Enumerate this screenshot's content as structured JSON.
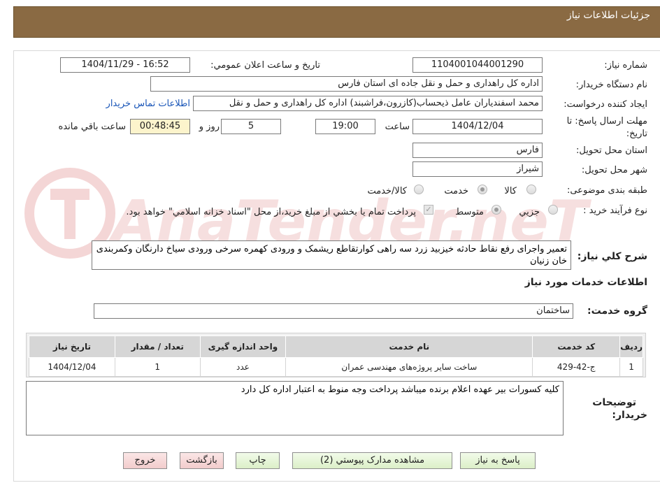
{
  "header": {
    "title": "جزئیات اطلاعات نیاز"
  },
  "form": {
    "need_number_label": "شماره نیاز:",
    "need_number": "1104001044001290",
    "announce_label": "تاریخ و ساعت اعلان عمومي:",
    "announce_value": "1404/11/29 - 16:52",
    "buyer_org_label": "نام دستگاه خريدار:",
    "buyer_org": "اداره کل راهداری و حمل و نقل جاده ای استان فارس",
    "requester_label": "ايجاد کننده درخواست:",
    "requester": "محمد اسفندیاران عامل ذیحساب(کازرون،فراشبند) اداره کل راهداری و حمل و نقل",
    "contact_link": "اطلاعات تماس خريدار",
    "deadline_label_1": "مهلت ارسال پاسخ: تا",
    "deadline_label_2": "تاريخ:",
    "deadline_date": "1404/12/04",
    "time_label": "ساعت",
    "deadline_time": "19:00",
    "days_value": "5",
    "days_label": "روز و",
    "remaining_time": "00:48:45",
    "remaining_label": "ساعت باقي مانده",
    "province_label": "استان محل تحويل:",
    "province": "فارس",
    "city_label": "شهر محل تحويل:",
    "city": "شيراز",
    "category_label": "طبقه بندی موضوعی:",
    "category_options": [
      "کالا",
      "خدمت",
      "کالا/خدمت"
    ],
    "category_selected": "خدمت",
    "process_label": "نوع فرآيند خريد :",
    "process_options": [
      "جزيي",
      "متوسط"
    ],
    "process_selected": "متوسط",
    "payment_note": "پرداخت تمام يا بخشي از مبلغ خريد،از محل \"اسناد خزانه اسلامي\" خواهد بود.",
    "description_label": "شرح کلي نياز:",
    "description": "تعمیر واجرای رفع نقاط حادثه خیزبید زرد سه راهی کوارتقاطع ریشمک و ورودی کهمره سرخی ورودی سیاخ دارنگان وکمربندی خان زنیان"
  },
  "services": {
    "section_title": "اطلاعات خدمات مورد نياز",
    "group_label": "گروه خدمت:",
    "group_value": "ساختمان",
    "columns": [
      "رديف",
      "کد خدمت",
      "نام خدمت",
      "واحد اندازه گيری",
      "تعداد / مقدار",
      "تاريخ نياز"
    ],
    "rows": [
      [
        "1",
        "ج-42-429",
        "ساخت ساير پروژه‌های مهندسی عمران",
        "عدد",
        "1",
        "1404/12/04"
      ]
    ]
  },
  "buyer_notes": {
    "label_1": "توضيحات",
    "label_2": "خريدار:",
    "text": "کلیه کسورات بیر عهده اعلام برنده میباشد پرداخت وجه منوط به اعتبار اداره کل دارد"
  },
  "buttons": {
    "reply": "پاسخ به نياز",
    "attachments": "مشاهده مدارک پيوستي (2)",
    "print": "چاپ",
    "back": "بازگشت",
    "exit": "خروج"
  },
  "watermark": {
    "text": "AnaTender.neT"
  },
  "colors": {
    "header_bg": "#8a6a43",
    "timer_bg": "#fcf4cc",
    "link": "#1a56b8",
    "watermark": "#f2d2d2"
  }
}
